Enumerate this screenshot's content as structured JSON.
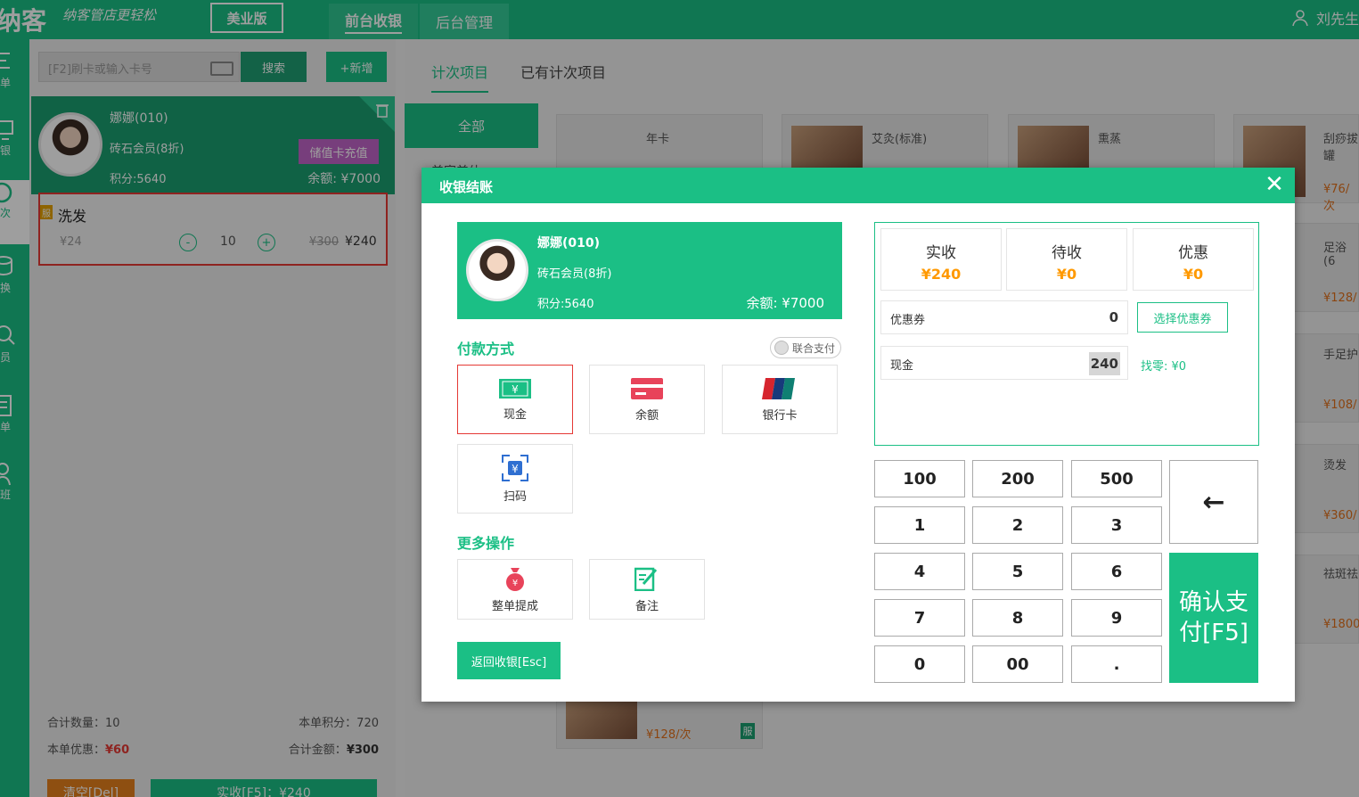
{
  "app": {
    "logo_text": "纳客",
    "slogan": "纳客管店更轻松",
    "edition": "美业版",
    "tabs": [
      "前台收银",
      "后台管理"
    ],
    "user": "刘先生"
  },
  "rail": [
    "单",
    "银",
    "次",
    "换",
    "员",
    "单",
    "班"
  ],
  "left": {
    "card_placeholder": "[F2]刷卡或输入卡号",
    "search_label": "搜索",
    "add_label": "+新增",
    "member": {
      "name": "娜娜(010)",
      "level": "砖石会员(8折)",
      "points": "积分:5640",
      "balance": "余额: ¥7000",
      "recharge_label": "储值卡充值"
    },
    "cart_item": {
      "badge": "服",
      "name": "洗发",
      "unit_price": "¥24",
      "minus": "-",
      "qty": "10",
      "plus": "+",
      "original_total": "¥300",
      "total": "¥240"
    },
    "summary": {
      "count_label": "合计数量：10",
      "points_label": "本单积分：720",
      "discount_prefix": "本单优惠：",
      "discount_value": "¥60",
      "amount_prefix": "合计金额：",
      "amount_value": "¥300"
    },
    "bottom_buttons": [
      "清空[Del]",
      "实收[F5]：¥240"
    ]
  },
  "right": {
    "tabs": [
      "计次项目",
      "已有计次项目"
    ],
    "categories": [
      "全部",
      "美容美体"
    ],
    "services": [
      {
        "name": "年卡",
        "price": ""
      },
      {
        "name": "艾灸(标准)",
        "price": ""
      },
      {
        "name": "熏蒸",
        "price": ""
      },
      {
        "name": "刮痧拔罐",
        "price": "¥76/次"
      },
      {
        "name": "足浴(6",
        "price": "¥128/"
      },
      {
        "name": "手足护",
        "price": "¥108/"
      },
      {
        "name": "烫发",
        "price": "¥360/"
      },
      {
        "name": "祛斑祛",
        "price": "¥1800"
      },
      {
        "name": "",
        "price": "¥128/次",
        "badge": "服"
      }
    ]
  },
  "modal": {
    "title": "收银结账",
    "close": "✕",
    "member": {
      "name": "娜娜(010)",
      "level": "砖石会员(8折)",
      "points": "积分:5640",
      "balance": "余额: ¥7000"
    },
    "pay_title": "付款方式",
    "combined_pay": "联合支付",
    "pay_methods": [
      "现金",
      "余额",
      "银行卡",
      "扫码"
    ],
    "more_title": "更多操作",
    "more_ops": [
      "整单提成",
      "备注"
    ],
    "back_label": "返回收银[Esc]",
    "stats": [
      {
        "label": "实收",
        "value": "¥240"
      },
      {
        "label": "待收",
        "value": "¥0"
      },
      {
        "label": "优惠",
        "value": "¥0"
      }
    ],
    "coupon_label": "优惠券",
    "coupon_value": "0",
    "choose_coupon": "选择优惠券",
    "cash_label": "现金",
    "cash_value": "240",
    "change": "找零: ¥0",
    "keys": [
      "100",
      "200",
      "500",
      "1",
      "2",
      "3",
      "4",
      "5",
      "6",
      "7",
      "8",
      "9",
      "0",
      "00",
      "."
    ],
    "backspace": "←",
    "confirm": "确认支付[F5]",
    "bank_logo": "UnionPay 银联",
    "colors": {
      "brand": "#1bbf85",
      "accent_orange": "#ff9900",
      "danger": "#e53935",
      "recharge": "#c165c8"
    }
  }
}
